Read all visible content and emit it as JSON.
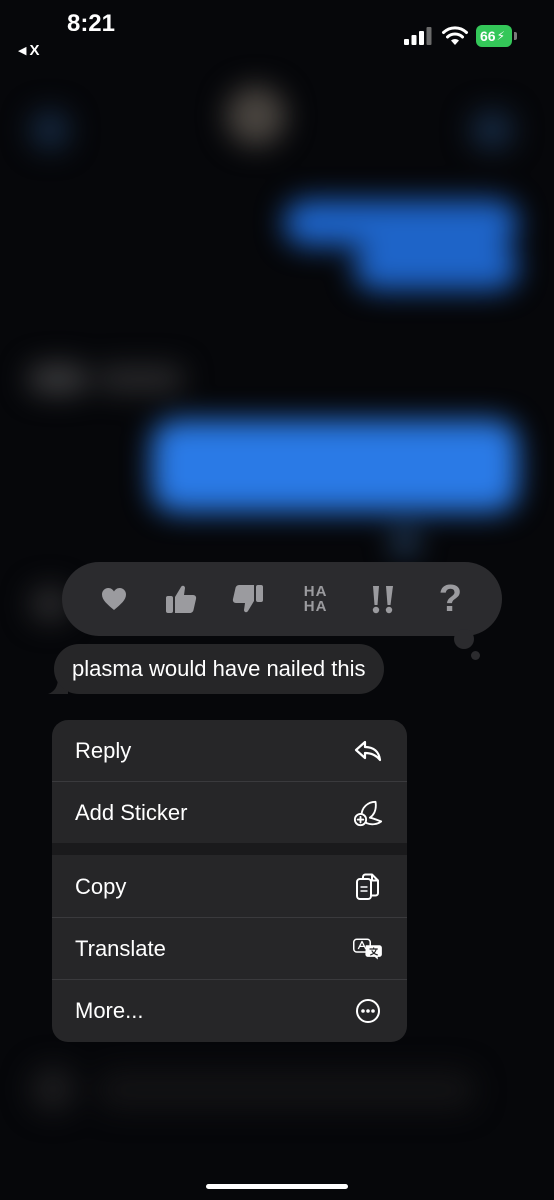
{
  "status_bar": {
    "time": "8:21",
    "back_app": "X",
    "battery": "66"
  },
  "reactions": [
    {
      "icon": "heart-icon"
    },
    {
      "icon": "thumbs-up-icon"
    },
    {
      "icon": "thumbs-down-icon"
    },
    {
      "icon": "haha-icon",
      "text_top": "HA",
      "text_bottom": "HA"
    },
    {
      "icon": "exclamation-icon"
    },
    {
      "icon": "question-icon",
      "text": "?"
    }
  ],
  "message": {
    "text": "plasma would have nailed this"
  },
  "menu": {
    "items": [
      {
        "label": "Reply",
        "icon": "reply-icon"
      },
      {
        "label": "Add Sticker",
        "icon": "add-sticker-icon"
      },
      {
        "label": "Copy",
        "icon": "copy-icon"
      },
      {
        "label": "Translate",
        "icon": "translate-icon"
      },
      {
        "label": "More...",
        "icon": "more-icon"
      }
    ]
  },
  "colors": {
    "background": "#06070a",
    "menu_bg": "#262628",
    "reaction_icon": "#9b9b9f",
    "battery": "#34c759",
    "imessage_blue": "#1f6fe0"
  }
}
